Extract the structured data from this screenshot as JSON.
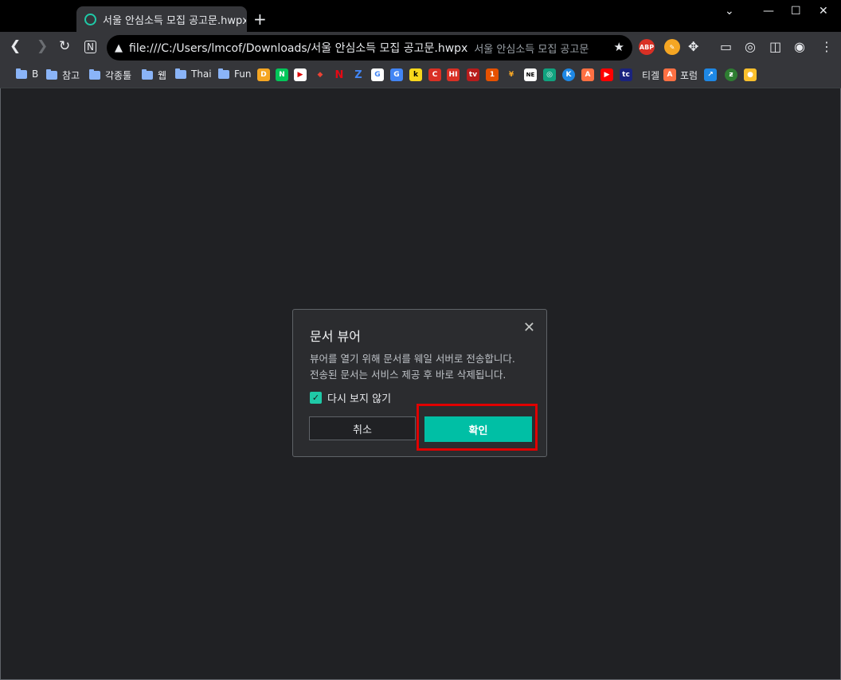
{
  "browser": {
    "tab_title": "서울 안심소득 모집 공고문.hwpx",
    "new_tab": "+",
    "url": "file:///C:/Users/lmcof/Downloads/서울 안심소득 모집 공고문.hwpx",
    "url_title_suffix": "서울 안심소득 모집 공고문",
    "window_controls": [
      "⌄",
      "—",
      "☐",
      "✕"
    ]
  },
  "extensions": {
    "abp": "ABP"
  },
  "bookmarks": [
    {
      "label": "B",
      "type": "folder"
    },
    {
      "label": "참고",
      "type": "folder"
    },
    {
      "label": "각종툴",
      "type": "folder"
    },
    {
      "label": "웹",
      "type": "folder"
    },
    {
      "label": "Thai",
      "type": "folder"
    },
    {
      "label": "Fun",
      "type": "folder"
    }
  ],
  "bookmark_icons": [
    "D",
    "N",
    "▶",
    "◆",
    "N",
    "Z",
    "G",
    "G",
    "k",
    "C",
    "HI",
    "tv",
    "1",
    "¥",
    "NE",
    "◎",
    "K",
    "A",
    "▶",
    "tc"
  ],
  "bookmark_tail": [
    {
      "label": "티겔"
    },
    {
      "label": "포럼"
    }
  ],
  "dialog": {
    "title": "문서 뷰어",
    "close": "✕",
    "message_line1": "뷰어를 열기 위해 문서를 웨일 서버로 전송합니다.",
    "message_line2": "전송된 문서는 서비스 제공 후 바로 삭제됩니다.",
    "checkbox_label": "다시 보지 않기",
    "checkbox_checked": true,
    "cancel_label": "취소",
    "confirm_label": "확인"
  },
  "colors": {
    "accent": "#00bfa5",
    "highlight": "#e00000",
    "background": "#202124"
  }
}
